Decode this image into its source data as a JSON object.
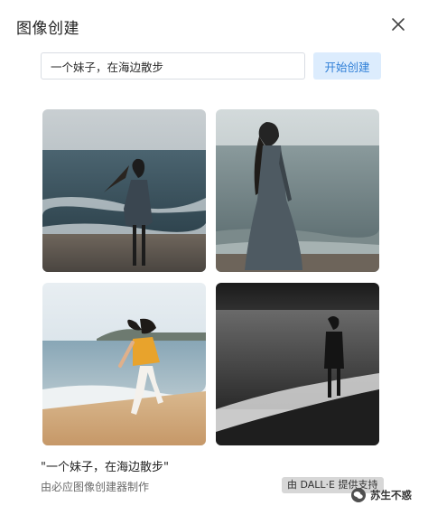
{
  "dialog": {
    "title": "图像创建",
    "close_icon": "close-icon"
  },
  "prompt": {
    "value": "一个妹子，在海边散步",
    "button_label": "开始创建"
  },
  "results": {
    "images": [
      {
        "name": "generated-image-1",
        "alt": "girl in dress on beach with waves"
      },
      {
        "name": "generated-image-2",
        "alt": "girl in long dress at shoreline"
      },
      {
        "name": "generated-image-3",
        "alt": "girl in yellow top running on sand"
      },
      {
        "name": "generated-image-4",
        "alt": "black and white girl walking on shore"
      }
    ],
    "caption": "\"一个妹子，在海边散步\"",
    "maker": "由必应图像创建器制作",
    "provider_badge": "由 DALL·E 提供支持"
  },
  "watermark": {
    "text": "苏生不惑",
    "icon": "wechat-icon"
  },
  "colors": {
    "button_bg": "#dcecfd",
    "button_text": "#2f7fd7",
    "badge_bg": "#d7d7d7"
  }
}
